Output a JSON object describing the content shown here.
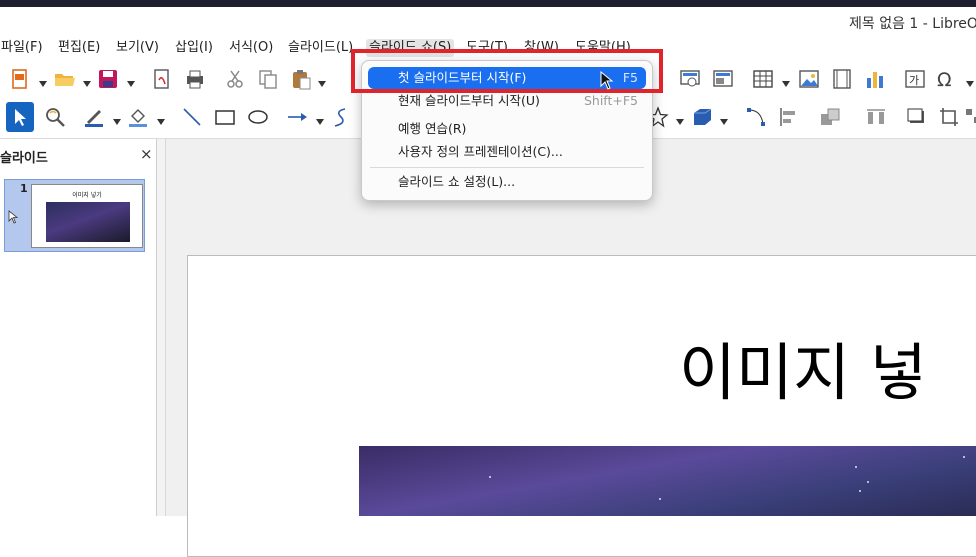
{
  "window": {
    "title": "제목 없음 1 - LibreOff"
  },
  "menubar": {
    "items": [
      {
        "label": "파일(F)"
      },
      {
        "label": "편집(E)"
      },
      {
        "label": "보기(V)"
      },
      {
        "label": "삽입(I)"
      },
      {
        "label": "서식(O)"
      },
      {
        "label": "슬라이드(L)"
      },
      {
        "label": "슬라이드 쇼(S)"
      },
      {
        "label": "도구(T)"
      },
      {
        "label": "창(W)"
      },
      {
        "label": "도움말(H)"
      }
    ]
  },
  "toolbar1": {
    "icons": [
      "new-document",
      "open-folder",
      "save",
      "export-pdf",
      "print",
      "cut",
      "copy",
      "paste",
      "spellcheck",
      "slide-show-display",
      "slide-master",
      "table",
      "image",
      "media",
      "chart",
      "text-box",
      "special-character"
    ]
  },
  "toolbar2": {
    "icons": [
      "select-arrow",
      "zoom",
      "line-color",
      "fill-color",
      "line",
      "rectangle",
      "ellipse",
      "arrow-line",
      "curve",
      "star-shape",
      "3d-object",
      "points",
      "align",
      "arrange",
      "distribute",
      "shadow",
      "crop",
      "more"
    ]
  },
  "slides_panel": {
    "title": "슬라이드",
    "close_label": "×",
    "thumbnails": [
      {
        "number": "1",
        "title": "이미지 넣기"
      }
    ]
  },
  "slide": {
    "title_text": "이미지 넣"
  },
  "slideshow_menu": {
    "items": [
      {
        "label": "첫 슬라이드부터 시작(F)",
        "shortcut": "F5",
        "highlighted": true
      },
      {
        "label": "현재 슬라이드부터 시작(U)",
        "shortcut": "Shift+F5"
      },
      {
        "label": "예행 연습(R)",
        "shortcut": ""
      },
      {
        "label": "사용자 정의 프레젠테이션(C)...",
        "shortcut": ""
      },
      {
        "label": "슬라이드 쇼 설정(L)...",
        "shortcut": ""
      }
    ]
  },
  "colors": {
    "accent": "#1a6ff0",
    "highlight_box": "#e0242c",
    "selection": "#b4c7ec"
  }
}
